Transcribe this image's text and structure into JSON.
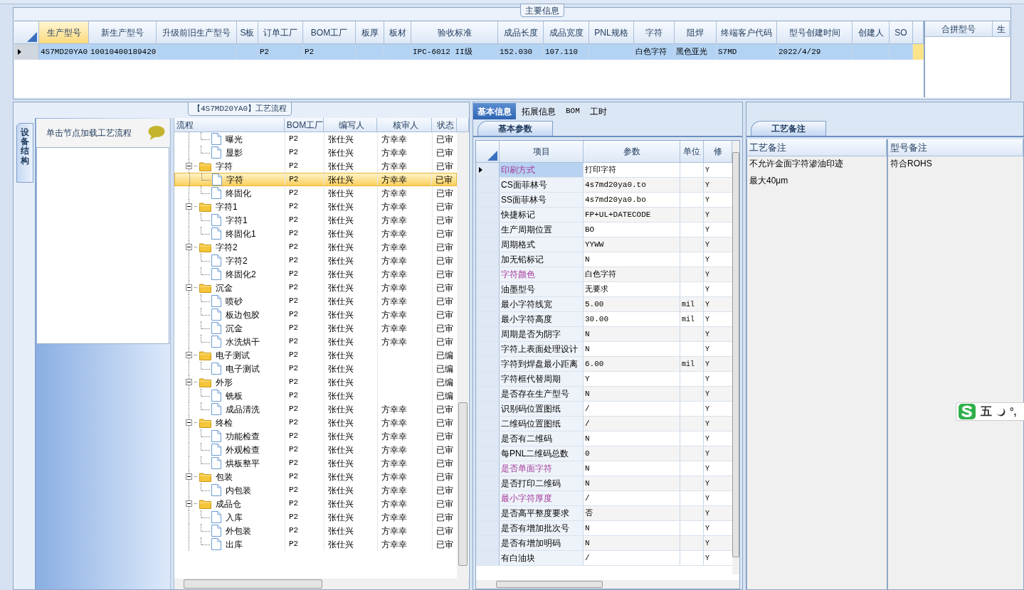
{
  "main_info": {
    "title": "主要信息",
    "columns": [
      {
        "label": "生产型号",
        "selected": true
      },
      {
        "label": "新生产型号",
        "selected": false
      },
      {
        "label": "升级前旧生产型号",
        "selected": false
      },
      {
        "label": "S板",
        "selected": false
      },
      {
        "label": "订单工厂",
        "selected": false
      },
      {
        "label": "BOM工厂",
        "selected": false
      },
      {
        "label": "板厚",
        "selected": false
      },
      {
        "label": "板材",
        "selected": false
      },
      {
        "label": "验收标准",
        "selected": false
      },
      {
        "label": "成品长度",
        "selected": false
      },
      {
        "label": "成品宽度",
        "selected": false
      },
      {
        "label": "PNL规格",
        "selected": false
      },
      {
        "label": "字符",
        "selected": false
      },
      {
        "label": "阻焊",
        "selected": false
      },
      {
        "label": "终端客户代码",
        "selected": false
      },
      {
        "label": "型号创建时间",
        "selected": false
      },
      {
        "label": "创建人",
        "selected": false
      },
      {
        "label": "SO",
        "selected": false
      }
    ],
    "rows": [
      {
        "selected": true,
        "cells": [
          "4S7MD20YA0",
          "10010400189420",
          null,
          null,
          "P2",
          "P2",
          null,
          null,
          "IPC-6012 II级",
          "152.030",
          "107.110",
          null,
          "白色字符",
          "黑色亚光",
          "S7MD",
          "2022/4/29",
          null,
          null
        ]
      }
    ],
    "merge_columns": [
      "合拼型号",
      "生"
    ]
  },
  "process_flow": {
    "title": "【4S7MD20YA0】工艺流程",
    "side_tab": "设备结构",
    "hint": "单击节点加载工艺流程",
    "columns": [
      "流程",
      "BOM工厂",
      "编写人",
      "核审人",
      "状态"
    ],
    "tree": [
      {
        "children": [
          {
            "label": "曝光",
            "bom": "P2",
            "writer": "张仕兴",
            "reviewer": "方幸幸",
            "status": "已审",
            "selected": false
          },
          {
            "label": "显影",
            "bom": "P2",
            "writer": "张仕兴",
            "reviewer": "方幸幸",
            "status": "已审",
            "selected": false
          }
        ]
      },
      {
        "label": "字符",
        "bom": "P2",
        "writer": "张仕兴",
        "reviewer": "方幸幸",
        "status": "已审",
        "selected": false,
        "expanded": true,
        "children": [
          {
            "label": "字符",
            "bom": "P2",
            "writer": "张仕兴",
            "reviewer": "方幸幸",
            "status": "已审",
            "selected": true
          },
          {
            "label": "终固化",
            "bom": "P2",
            "writer": "张仕兴",
            "reviewer": "方幸幸",
            "status": "已审",
            "selected": false
          }
        ]
      },
      {
        "label": "字符1",
        "bom": "P2",
        "writer": "张仕兴",
        "reviewer": "方幸幸",
        "status": "已审",
        "selected": false,
        "expanded": true,
        "children": [
          {
            "label": "字符1",
            "bom": "P2",
            "writer": "张仕兴",
            "reviewer": "方幸幸",
            "status": "已审",
            "selected": false
          },
          {
            "label": "终固化1",
            "bom": "P2",
            "writer": "张仕兴",
            "reviewer": "方幸幸",
            "status": "已审",
            "selected": false
          }
        ]
      },
      {
        "label": "字符2",
        "bom": "P2",
        "writer": "张仕兴",
        "reviewer": "方幸幸",
        "status": "已审",
        "selected": false,
        "expanded": true,
        "children": [
          {
            "label": "字符2",
            "bom": "P2",
            "writer": "张仕兴",
            "reviewer": "方幸幸",
            "status": "已审",
            "selected": false
          },
          {
            "label": "终固化2",
            "bom": "P2",
            "writer": "张仕兴",
            "reviewer": "方幸幸",
            "status": "已审",
            "selected": false
          }
        ]
      },
      {
        "label": "沉金",
        "bom": "P2",
        "writer": "张仕兴",
        "reviewer": "方幸幸",
        "status": "已审",
        "selected": false,
        "expanded": true,
        "children": [
          {
            "label": "喷砂",
            "bom": "P2",
            "writer": "张仕兴",
            "reviewer": "方幸幸",
            "status": "已审",
            "selected": false
          },
          {
            "label": "板边包胶",
            "bom": "P2",
            "writer": "张仕兴",
            "reviewer": "方幸幸",
            "status": "已审",
            "selected": false
          },
          {
            "label": "沉金",
            "bom": "P2",
            "writer": "张仕兴",
            "reviewer": "方幸幸",
            "status": "已审",
            "selected": false
          },
          {
            "label": "水洗烘干",
            "bom": "P2",
            "writer": "张仕兴",
            "reviewer": "方幸幸",
            "status": "已审",
            "selected": false
          }
        ]
      },
      {
        "label": "电子测试",
        "bom": "P2",
        "writer": "张仕兴",
        "status": "已编",
        "selected": false,
        "expanded": true,
        "children": [
          {
            "label": "电子测试",
            "bom": "P2",
            "writer": "张仕兴",
            "status": "已编",
            "selected": false
          }
        ]
      },
      {
        "label": "外形",
        "bom": "P2",
        "writer": "张仕兴",
        "status": "已编",
        "selected": false,
        "expanded": true,
        "children": [
          {
            "label": "铣板",
            "bom": "P2",
            "writer": "张仕兴",
            "status": "已编",
            "selected": false
          },
          {
            "label": "成品清洗",
            "bom": "P2",
            "writer": "张仕兴",
            "reviewer": "方幸幸",
            "status": "已审",
            "selected": false
          }
        ]
      },
      {
        "label": "终检",
        "bom": "P2",
        "writer": "张仕兴",
        "reviewer": "方幸幸",
        "status": "已审",
        "selected": false,
        "expanded": true,
        "children": [
          {
            "label": "功能检查",
            "bom": "P2",
            "writer": "张仕兴",
            "reviewer": "方幸幸",
            "status": "已审",
            "selected": false
          },
          {
            "label": "外观检查",
            "bom": "P2",
            "writer": "张仕兴",
            "reviewer": "方幸幸",
            "status": "已审",
            "selected": false
          },
          {
            "label": "烘板整平",
            "bom": "P2",
            "writer": "张仕兴",
            "reviewer": "方幸幸",
            "status": "已审",
            "selected": false
          }
        ]
      },
      {
        "label": "包装",
        "bom": "P2",
        "writer": "张仕兴",
        "reviewer": "方幸幸",
        "status": "已审",
        "selected": false,
        "expanded": true,
        "children": [
          {
            "label": "内包装",
            "bom": "P2",
            "writer": "张仕兴",
            "reviewer": "方幸幸",
            "status": "已审",
            "selected": false
          }
        ]
      },
      {
        "label": "成品仓",
        "bom": "P2",
        "writer": "张仕兴",
        "reviewer": "方幸幸",
        "status": "已审",
        "selected": false,
        "expanded": true,
        "children": [
          {
            "label": "入库",
            "bom": "P2",
            "writer": "张仕兴",
            "reviewer": "方幸幸",
            "status": "已审",
            "selected": false
          },
          {
            "label": "外包装",
            "bom": "P2",
            "writer": "张仕兴",
            "reviewer": "方幸幸",
            "status": "已审",
            "selected": false
          },
          {
            "label": "出库",
            "bom": "P2",
            "writer": "张仕兴",
            "reviewer": "方幸幸",
            "status": "已审",
            "selected": false
          }
        ]
      }
    ]
  },
  "details": {
    "tabs": [
      {
        "label": "基本信息",
        "selected": true
      },
      {
        "label": "拓展信息",
        "selected": false
      },
      {
        "label": "BOM",
        "selected": false
      },
      {
        "label": "工时",
        "selected": false
      }
    ],
    "sub_tab": "基本参数",
    "columns": [
      "项目",
      "参数",
      "单位",
      "修"
    ],
    "rows": [
      {
        "item": "印刷方式",
        "value": "打印字符",
        "modified": "Y",
        "highlighted": true,
        "selected": true
      },
      {
        "item": "CS面菲林号",
        "value": "4s7md20ya0.to",
        "modified": "Y",
        "highlighted": false,
        "selected": false
      },
      {
        "item": "SS面菲林号",
        "value": "4s7md20ya0.bo",
        "modified": "Y",
        "highlighted": false,
        "selected": false
      },
      {
        "item": "快捷标记",
        "value": "FP+UL+DATECODE",
        "modified": "Y",
        "highlighted": false,
        "selected": false
      },
      {
        "item": "生产周期位置",
        "value": "BO",
        "modified": "Y",
        "highlighted": false,
        "selected": false
      },
      {
        "item": "周期格式",
        "value": "YYWW",
        "modified": "Y",
        "highlighted": false,
        "selected": false
      },
      {
        "item": "加无铅标记",
        "value": "N",
        "modified": "Y",
        "highlighted": false,
        "selected": false
      },
      {
        "item": "字符颜色",
        "value": "白色字符",
        "modified": "Y",
        "highlighted": true,
        "selected": false
      },
      {
        "item": "油墨型号",
        "value": "无要求",
        "modified": "Y",
        "highlighted": false,
        "selected": false
      },
      {
        "item": "最小字符线宽",
        "value": "5.00",
        "unit": "mil",
        "modified": "Y",
        "highlighted": false,
        "selected": false
      },
      {
        "item": "最小字符高度",
        "value": "30.00",
        "unit": "mil",
        "modified": "Y",
        "highlighted": false,
        "selected": false
      },
      {
        "item": "周期是否为阴字",
        "value": "N",
        "modified": "Y",
        "highlighted": false,
        "selected": false
      },
      {
        "item": "字符上表面处理设计",
        "value": "N",
        "modified": "Y",
        "highlighted": false,
        "selected": false
      },
      {
        "item": "字符到焊盘最小距离",
        "value": "6.00",
        "unit": "mil",
        "modified": "Y",
        "highlighted": false,
        "selected": false
      },
      {
        "item": "字符框代替周期",
        "value": "Y",
        "modified": "Y",
        "highlighted": false,
        "selected": false
      },
      {
        "item": "是否存在生产型号",
        "value": "N",
        "modified": "Y",
        "highlighted": false,
        "selected": false
      },
      {
        "item": "识别码位置图纸",
        "value": "/",
        "modified": "Y",
        "highlighted": false,
        "selected": false
      },
      {
        "item": "二维码位置图纸",
        "value": "/",
        "modified": "Y",
        "highlighted": false,
        "selected": false
      },
      {
        "item": "是否有二维码",
        "value": "N",
        "modified": "Y",
        "highlighted": false,
        "selected": false
      },
      {
        "item": "每PNL二维码总数",
        "value": "0",
        "modified": "Y",
        "highlighted": false,
        "selected": false
      },
      {
        "item": "是否单面字符",
        "value": "N",
        "modified": "Y",
        "highlighted": true,
        "selected": false
      },
      {
        "item": "是否打印二维码",
        "value": "N",
        "modified": "Y",
        "highlighted": false,
        "selected": false
      },
      {
        "item": "最小字符厚度",
        "value": "/",
        "modified": "Y",
        "highlighted": true,
        "selected": false
      },
      {
        "item": "是否高平整度要求",
        "value": "否",
        "modified": "Y",
        "highlighted": false,
        "selected": false
      },
      {
        "item": "是否有增加批次号",
        "value": "N",
        "modified": "Y",
        "highlighted": false,
        "selected": false
      },
      {
        "item": "是否有增加明码",
        "value": "N",
        "modified": "Y",
        "highlighted": false,
        "selected": false
      },
      {
        "item": "有白油块",
        "value": "/",
        "modified": "Y",
        "highlighted": false,
        "selected": false
      }
    ]
  },
  "notes": {
    "sub_tab": "工艺备注",
    "columns": [
      "工艺备注",
      "型号备注"
    ],
    "process_notes": [
      "不允许金面字符渗油印迹",
      "最大40μm"
    ],
    "model_notes": [
      "符合ROHS"
    ]
  },
  "ime_bar": {
    "mode": "五",
    "punctuation": "°,"
  }
}
